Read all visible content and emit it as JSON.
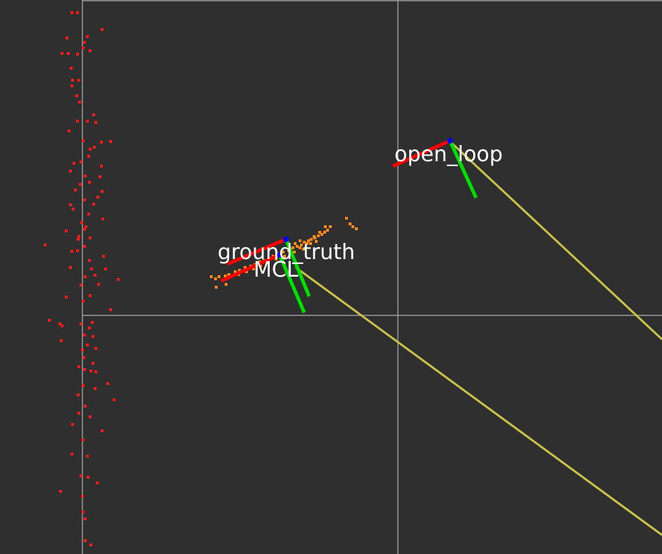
{
  "labels": {
    "ground_truth": "ground_truth",
    "mcl": "MCL",
    "open_loop": "open_loop"
  },
  "colors": {
    "background": "#2f2f2f",
    "grid": "#9a9a9a",
    "laser_points": "#ff1a1a",
    "particles": "#ff8a1a",
    "trajectory": "#c9c34a",
    "axis_x": "#ff0000",
    "axis_y": "#00e000",
    "origin": "#0000ff",
    "label_text": "#ffffff"
  }
}
